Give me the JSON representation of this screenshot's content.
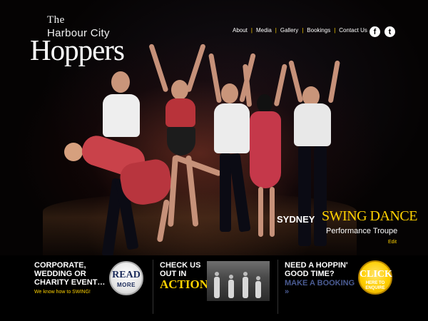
{
  "logo": {
    "the": "The",
    "city": "Harbour City",
    "name": "Hoppers"
  },
  "nav": {
    "items": [
      "About",
      "Media",
      "Gallery",
      "Bookings",
      "Contact Us"
    ],
    "separator": "|"
  },
  "social": {
    "facebook_glyph": "f",
    "twitter_glyph": "t",
    "facebook_icon": "facebook-icon",
    "twitter_icon": "twitter-icon"
  },
  "hero": {
    "tagline_city": "SYDNEY",
    "tagline_style": "SWING DANCE",
    "tagline_sub": "Performance Troupe",
    "edit_label": "Edit"
  },
  "promos": {
    "corporate": {
      "title": "CORPORATE, WEDDING OR CHARITY EVENT…",
      "subtitle": "We know how to SWING!",
      "button_top": "READ",
      "button_bottom": "MORE"
    },
    "check": {
      "title": "CHECK US OUT IN",
      "highlight": "ACTION!"
    },
    "booking": {
      "title": "NEED A HOPPIN' GOOD TIME?",
      "link": "MAKE A BOOKING »",
      "button_top": "CLICK",
      "button_bottom": "HERE TO ENQUIRE"
    }
  },
  "colors": {
    "accent": "#ffd200",
    "link_blue": "#4a5b92",
    "background": "#000000"
  }
}
